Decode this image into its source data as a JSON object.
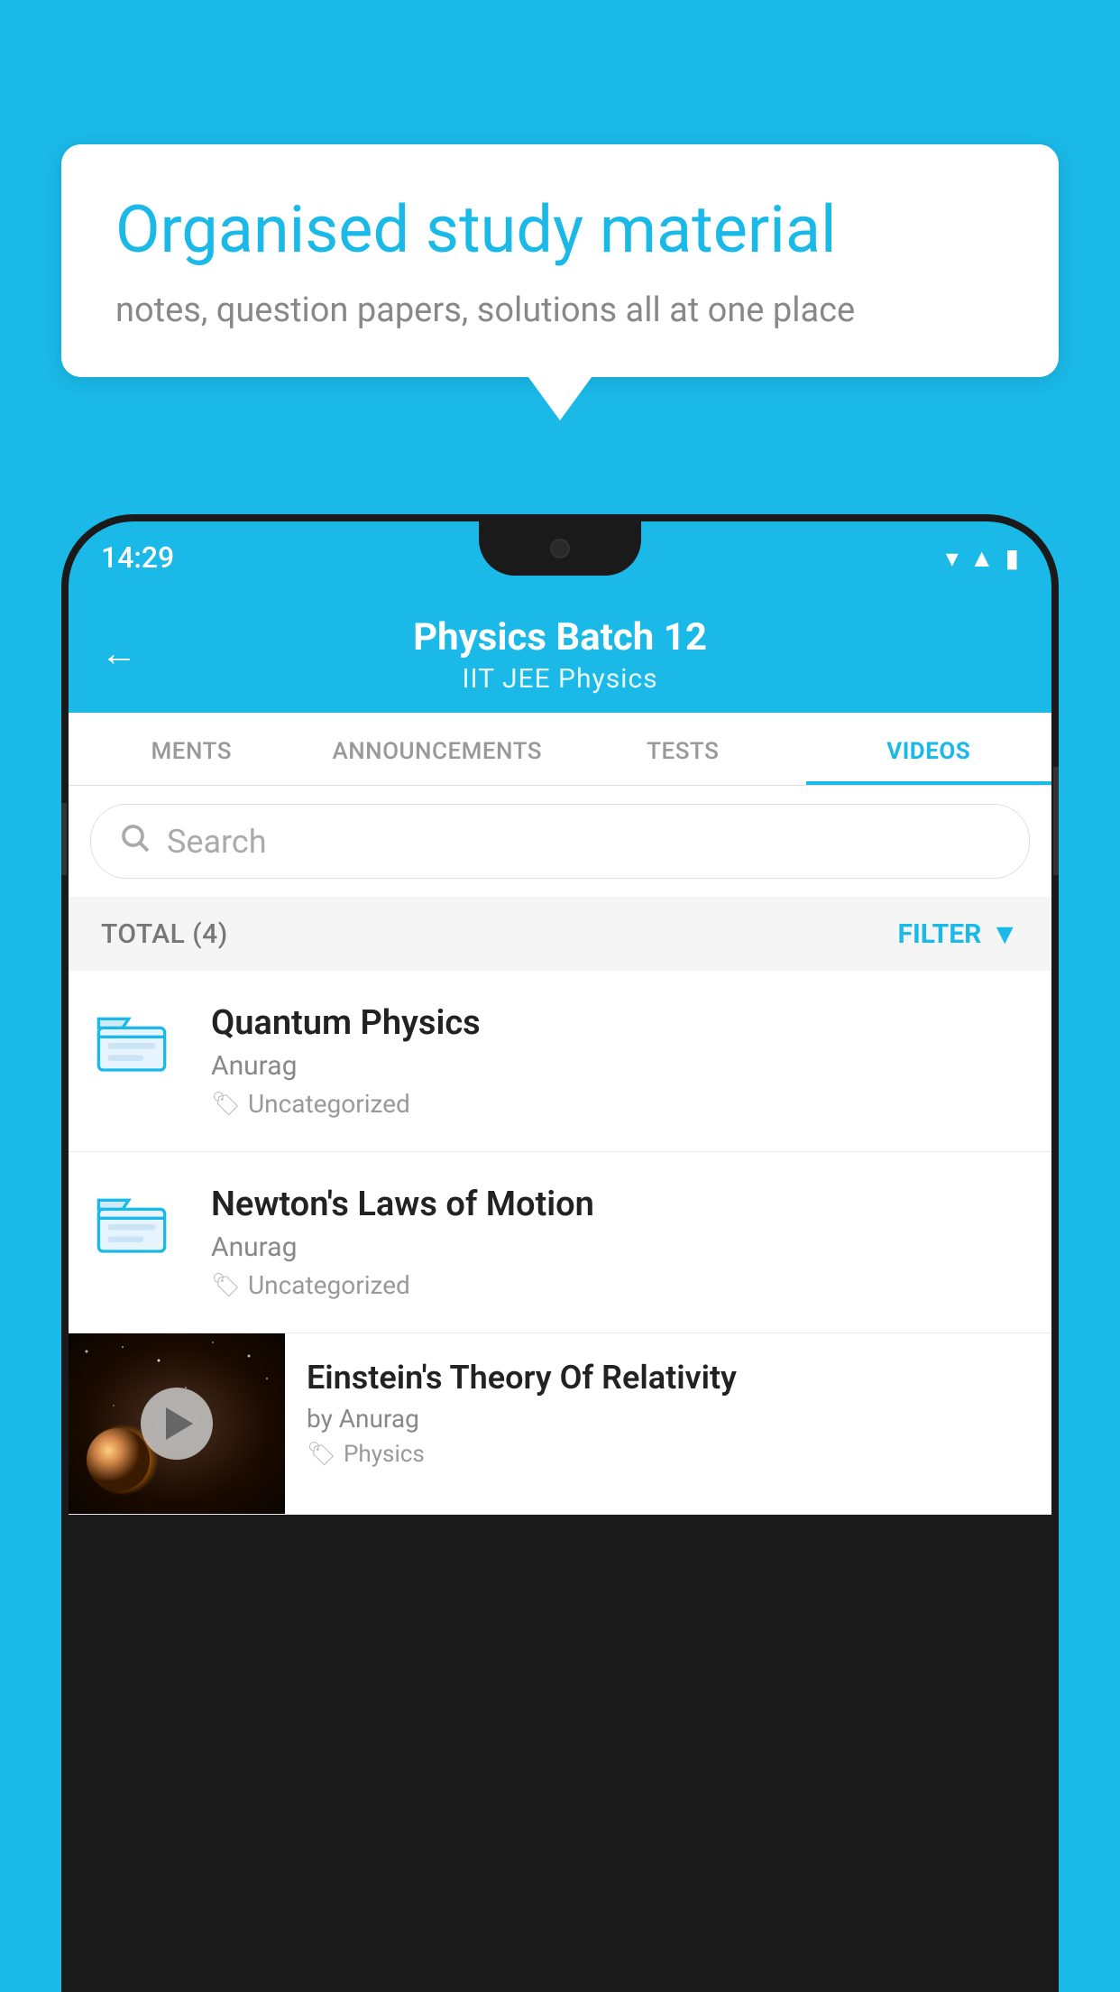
{
  "background_color": "#1ab9e8",
  "bubble": {
    "title": "Organised study material",
    "subtitle": "notes, question papers, solutions all at one place"
  },
  "status_bar": {
    "time": "14:29",
    "icons": [
      "wifi",
      "signal",
      "battery"
    ]
  },
  "header": {
    "back_label": "←",
    "title": "Physics Batch 12",
    "subtitle": "IIT JEE    Physics"
  },
  "tabs": [
    {
      "label": "MENTS",
      "active": false
    },
    {
      "label": "ANNOUNCEMENTS",
      "active": false
    },
    {
      "label": "TESTS",
      "active": false
    },
    {
      "label": "VIDEOS",
      "active": true
    }
  ],
  "search": {
    "placeholder": "Search"
  },
  "filter_bar": {
    "total_label": "TOTAL (4)",
    "filter_label": "FILTER"
  },
  "videos": [
    {
      "title": "Quantum Physics",
      "author": "Anurag",
      "tag": "Uncategorized",
      "has_thumbnail": false
    },
    {
      "title": "Newton's Laws of Motion",
      "author": "Anurag",
      "tag": "Uncategorized",
      "has_thumbnail": false
    },
    {
      "title": "Einstein's Theory Of Relativity",
      "author": "by Anurag",
      "tag": "Physics",
      "has_thumbnail": true
    }
  ]
}
